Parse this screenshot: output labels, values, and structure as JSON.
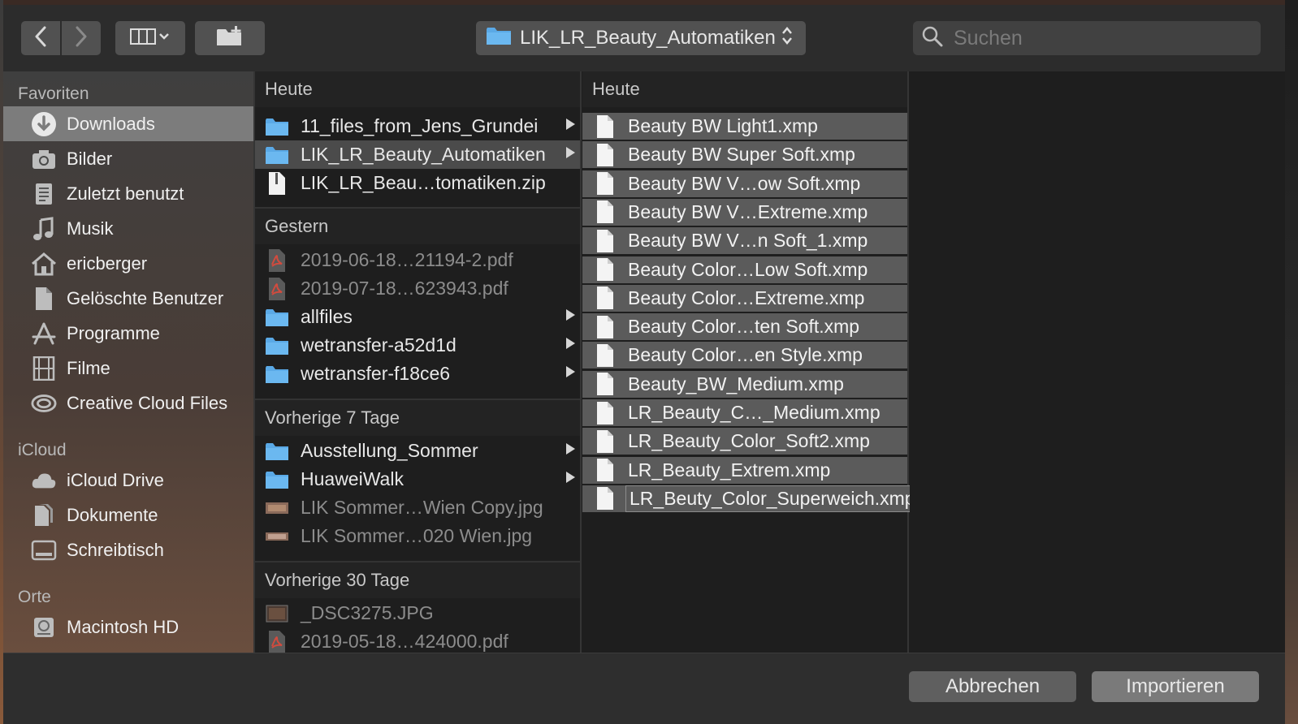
{
  "toolbar": {
    "back_icon": "chevron-left-icon",
    "forward_icon": "chevron-right-icon",
    "view_icon": "columns-view-icon",
    "new_folder_icon": "new-folder-icon",
    "path_label": "LIK_LR_Beauty_Automatiken",
    "search_placeholder": "Suchen"
  },
  "sidebar": {
    "favorites_title": "Favoriten",
    "favorites": [
      {
        "label": "Downloads",
        "icon": "download-icon"
      },
      {
        "label": "Bilder",
        "icon": "camera-icon"
      },
      {
        "label": "Zuletzt benutzt",
        "icon": "recents-icon"
      },
      {
        "label": "Musik",
        "icon": "music-note-icon"
      },
      {
        "label": "ericberger",
        "icon": "home-icon"
      },
      {
        "label": "Gelöschte Benutzer",
        "icon": "document-icon"
      },
      {
        "label": "Programme",
        "icon": "apps-icon"
      },
      {
        "label": "Filme",
        "icon": "film-icon"
      },
      {
        "label": "Creative Cloud Files",
        "icon": "creative-cloud-icon"
      }
    ],
    "icloud_title": "iCloud",
    "icloud": [
      {
        "label": "iCloud Drive",
        "icon": "cloud-icon"
      },
      {
        "label": "Dokumente",
        "icon": "documents-icon"
      },
      {
        "label": "Schreibtisch",
        "icon": "desktop-icon"
      }
    ],
    "places_title": "Orte",
    "places": [
      {
        "label": "Macintosh HD",
        "icon": "hard-drive-icon"
      }
    ]
  },
  "column1": {
    "groups": [
      {
        "title": "Heute",
        "items": [
          {
            "label": "11_files_from_Jens_Grundei",
            "type": "folder"
          },
          {
            "label": "LIK_LR_Beauty_Automatiken",
            "type": "folder"
          },
          {
            "label": "LIK_LR_Beau…tomatiken.zip",
            "type": "zip"
          }
        ]
      },
      {
        "title": "Gestern",
        "items": [
          {
            "label": "2019-06-18…21194-2.pdf",
            "type": "pdf"
          },
          {
            "label": "2019-07-18…623943.pdf",
            "type": "pdf"
          },
          {
            "label": "allfiles",
            "type": "folder"
          },
          {
            "label": "wetransfer-a52d1d",
            "type": "folder"
          },
          {
            "label": "wetransfer-f18ce6",
            "type": "folder"
          }
        ]
      },
      {
        "title": "Vorherige 7 Tage",
        "items": [
          {
            "label": "Ausstellung_Sommer",
            "type": "folder"
          },
          {
            "label": "HuaweiWalk",
            "type": "folder"
          },
          {
            "label": "LIK Sommer…Wien Copy.jpg",
            "type": "image"
          },
          {
            "label": "LIK Sommer…020 Wien.jpg",
            "type": "image"
          }
        ]
      },
      {
        "title": "Vorherige 30 Tage",
        "items": [
          {
            "label": "_DSC3275.JPG",
            "type": "image"
          },
          {
            "label": "2019-05-18…424000.pdf",
            "type": "pdf"
          }
        ]
      }
    ]
  },
  "column2": {
    "title": "Heute",
    "files": [
      "Beauty BW Light1.xmp",
      "Beauty BW Super Soft.xmp",
      "Beauty BW V…ow Soft.xmp",
      "Beauty BW V…Extreme.xmp",
      "Beauty BW V…n Soft_1.xmp",
      "Beauty Color…Low Soft.xmp",
      "Beauty Color…Extreme.xmp",
      "Beauty Color…ten Soft.xmp",
      "Beauty Color…en Style.xmp",
      "Beauty_BW_Medium.xmp",
      "LR_Beauty_C…_Medium.xmp",
      "LR_Beauty_Color_Soft2.xmp",
      "LR_Beauty_Extrem.xmp",
      "LR_Beuty_Color_Superweich.xmp"
    ]
  },
  "buttons": {
    "cancel": "Abbrechen",
    "import": "Importieren"
  },
  "colors": {
    "folder_blue": "#5aa9e6",
    "window_bg": "#1e1e1e",
    "selected_sidebar": "#7c7c7c"
  }
}
